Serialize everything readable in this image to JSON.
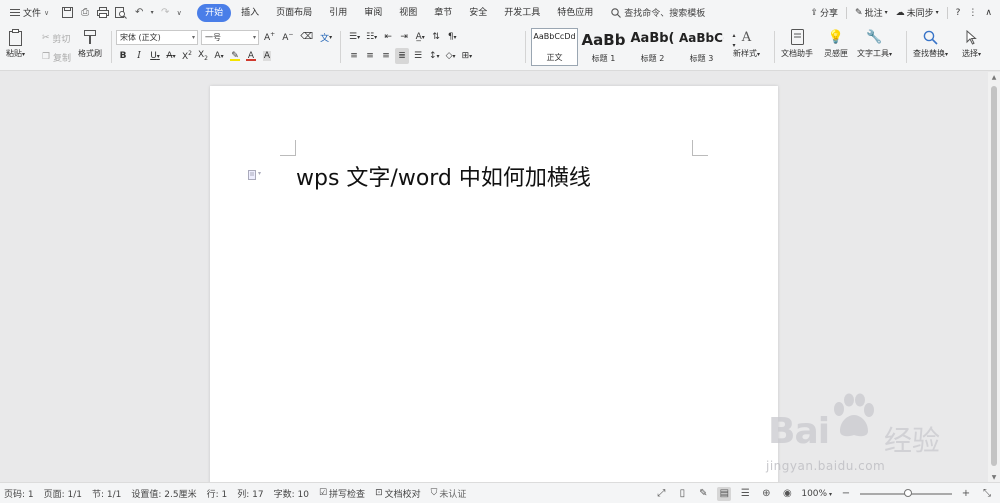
{
  "menubar": {
    "file_label": "文件",
    "tabs": [
      {
        "label": "开始",
        "active": true
      },
      {
        "label": "插入"
      },
      {
        "label": "页面布局"
      },
      {
        "label": "引用"
      },
      {
        "label": "审阅"
      },
      {
        "label": "视图"
      },
      {
        "label": "章节"
      },
      {
        "label": "安全"
      },
      {
        "label": "开发工具"
      },
      {
        "label": "特色应用"
      }
    ],
    "search_label": "查找命令、搜索模板",
    "share_label": "分享",
    "comment_label": "批注",
    "sync_label": "未同步",
    "accent_color": "#4a7ee8"
  },
  "ribbon": {
    "paste_label": "粘贴",
    "cut_label": "剪切",
    "copy_label": "复制",
    "format_painter_label": "格式刷",
    "font_name": "宋体 (正文)",
    "font_size": "一号",
    "bold": "B",
    "italic": "I",
    "underline": "U",
    "styles": [
      {
        "sample": "AaBbCcDd",
        "name": "正文"
      },
      {
        "sample": "AaBb",
        "name": "标题 1"
      },
      {
        "sample": "AaBb(",
        "name": "标题 2"
      },
      {
        "sample": "AaBbC(",
        "name": "标题 3"
      }
    ],
    "new_style_label": "新样式",
    "doc_assistant_label": "文档助手",
    "inspiration_label": "灵感匣",
    "text_tools_label": "文字工具",
    "find_replace_label": "查找替换",
    "select_label": "选择",
    "highlight_color": "#f5e400",
    "font_color": "#d03a2e"
  },
  "document": {
    "text": "wps 文字/word 中如何加横线"
  },
  "statusbar": {
    "page_code": "页码: 1",
    "pages": "页面: 1/1",
    "section": "节: 1/1",
    "setting": "设置值: 2.5厘米",
    "line": "行: 1",
    "column": "列: 17",
    "word_count": "字数: 10",
    "spell_check": "拼写检查",
    "doc_proof": "文档校对",
    "unverified": "未认证",
    "zoom": "100%"
  },
  "watermark": {
    "logo_text": "Bai",
    "logo_cn": "经验",
    "url": "jingyan.baidu.com"
  }
}
